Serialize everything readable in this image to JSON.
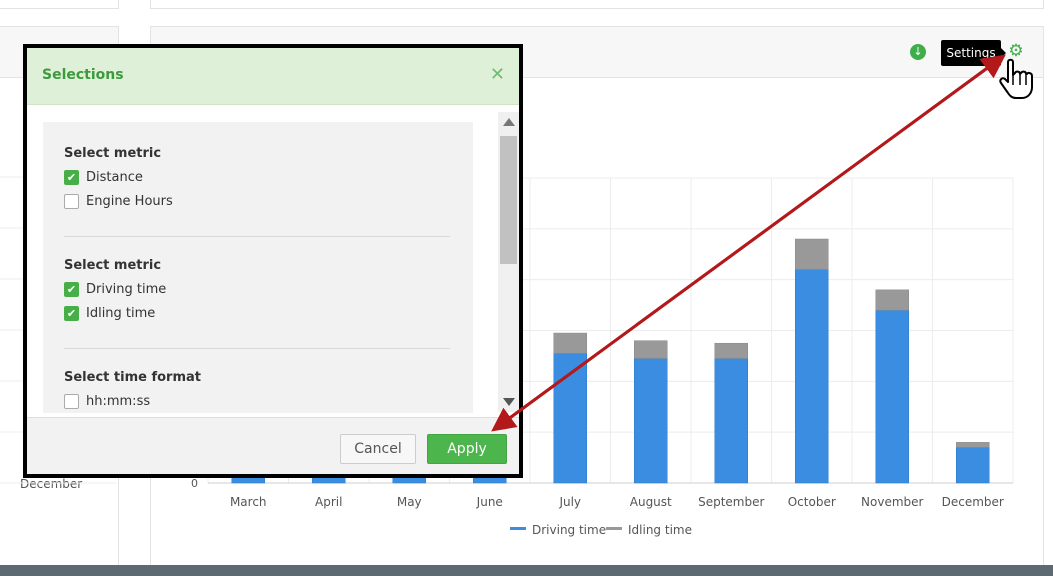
{
  "header": {
    "tooltip": "Settings",
    "download_icon": "download-circle-icon",
    "settings_icon": "gear-icon"
  },
  "left_panel": {
    "x_label": "December"
  },
  "chart_data": {
    "type": "bar",
    "stacked": true,
    "categories": [
      "March",
      "April",
      "May",
      "June",
      "July",
      "August",
      "September",
      "October",
      "November",
      "December"
    ],
    "series": [
      {
        "name": "Driving time",
        "color": "#3a8de0",
        "values": [
          0.5,
          0.5,
          0.5,
          0.5,
          5.1,
          4.9,
          4.9,
          8.4,
          6.8,
          1.4
        ]
      },
      {
        "name": "Idling time",
        "color": "#999999",
        "values": [
          0,
          0,
          0,
          0,
          0.8,
          0.7,
          0.6,
          1.2,
          0.8,
          0.2
        ]
      }
    ],
    "y_tick_labels": [
      "0"
    ],
    "ylim": [
      0,
      12
    ],
    "grid": true,
    "legend": "bottom"
  },
  "modal": {
    "title": "Selections",
    "close_icon": "close-icon",
    "sections": [
      {
        "title": "Select metric",
        "options": [
          {
            "label": "Distance",
            "checked": true
          },
          {
            "label": "Engine Hours",
            "checked": false
          }
        ]
      },
      {
        "title": "Select metric",
        "options": [
          {
            "label": "Driving time",
            "checked": true
          },
          {
            "label": "Idling time",
            "checked": true
          }
        ]
      },
      {
        "title": "Select time format",
        "options": [
          {
            "label": "hh:mm:ss",
            "checked": false
          }
        ]
      }
    ],
    "cancel_label": "Cancel",
    "apply_label": "Apply"
  },
  "annotation_arrow_color": "#b3191b"
}
